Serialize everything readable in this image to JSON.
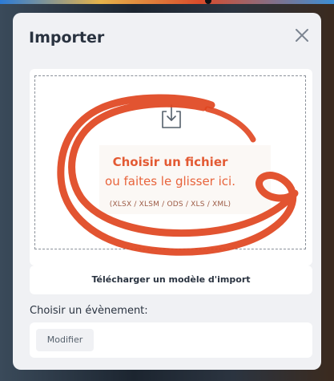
{
  "dialog": {
    "title": "Importer",
    "close_icon": "close-icon"
  },
  "dropzone": {
    "icon": "download-tray-icon",
    "choose_file": "Choisir un fichier",
    "drag_hint": "ou faites le glisser ici.",
    "formats": "(XLSX / XLSM / ODS / XLS / XML)"
  },
  "template_button": {
    "label": "Télécharger un modèle d'import"
  },
  "event": {
    "label": "Choisir un évènement:",
    "modify_label": "Modifier"
  },
  "colors": {
    "accent_orange": "#e35a33",
    "annotation_red": "#e0451f",
    "modal_background": "#f0f1f4"
  }
}
